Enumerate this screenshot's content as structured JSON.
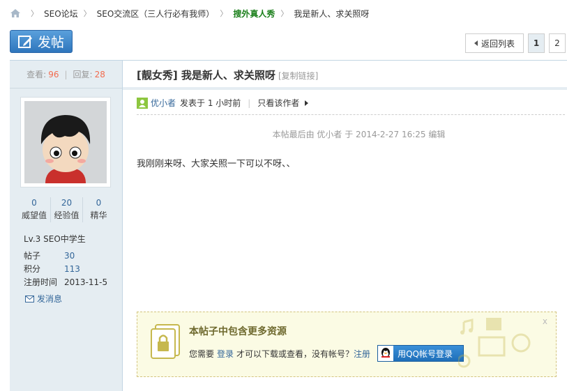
{
  "breadcrumb": {
    "items": [
      "SEO论坛",
      "SEO交流区（三人行必有我师）",
      "搜外真人秀",
      "我是新人、求关照呀"
    ]
  },
  "toolbar": {
    "post_label": "发帖",
    "back_label": "返回列表",
    "pages": [
      "1",
      "2"
    ]
  },
  "sidebar": {
    "views_label": "查看:",
    "views": "96",
    "replies_label": "回复:",
    "replies": "28",
    "stats": [
      {
        "value": "0",
        "label": "威望值"
      },
      {
        "value": "20",
        "label": "经验值"
      },
      {
        "value": "0",
        "label": "精华"
      }
    ],
    "level": "Lv.3 SEO中学生",
    "info": [
      {
        "key": "帖子",
        "value": "30"
      },
      {
        "key": "积分",
        "value": "113"
      },
      {
        "key": "注册时间",
        "value": "2013-11-5"
      }
    ],
    "message_label": "发消息"
  },
  "post": {
    "title": "[靓女秀] 我是新人、求关照呀",
    "copy_link": "[复制链接]",
    "author": "优小者",
    "posted_at": "发表于 1 小时前",
    "only_author": "只看该作者",
    "edit_note": "本帖最后由 优小者 于 2014-2-27 16:25 编辑",
    "content": "我刚刚来呀、大家关照一下可以不呀、、"
  },
  "attachment": {
    "heading": "本帖子中包含更多资源",
    "prefix": "您需要",
    "login": "登录",
    "middle": "才可以下载或查看，没有帐号？",
    "register": "注册",
    "qq_button": "用QQ帐号登录",
    "close": "x"
  },
  "colors": {
    "accent": "#336699",
    "highlight": "#f26c4f",
    "green": "#1a7f1a",
    "sidebar_bg": "#e5edf2"
  }
}
